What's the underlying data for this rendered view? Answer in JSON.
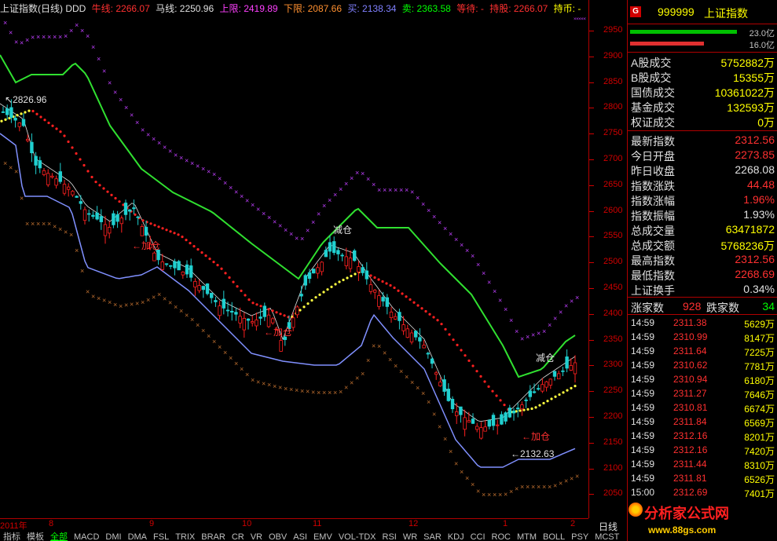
{
  "header": {
    "title": "上证指数(日线) DDD",
    "niu_label": "牛线:",
    "niu_value": "2266.07",
    "ma_label": "马线:",
    "ma_value": "2250.96",
    "upper_label": "上限:",
    "upper_value": "2419.89",
    "lower_label": "下限:",
    "lower_value": "2087.66",
    "buy_label": "买:",
    "buy_value": "2138.34",
    "sell_label": "卖:",
    "sell_value": "2363.58",
    "wait_label": "等待:",
    "wait_value": "-",
    "hold_label": "持股:",
    "hold_value": "2266.07",
    "holdcoin_label": "持币:",
    "holdcoin_value": "-"
  },
  "price_axis": [
    "2950",
    "2900",
    "2850",
    "2800",
    "2750",
    "2700",
    "2650",
    "2600",
    "2550",
    "2500",
    "2450",
    "2400",
    "2350",
    "2300",
    "2250",
    "2200",
    "2150",
    "2100",
    "2050"
  ],
  "time_axis": {
    "labels": [
      "2011年",
      "8",
      "9",
      "10",
      "11",
      "12",
      "1",
      "2"
    ],
    "period": "日线"
  },
  "chart_annotations": {
    "high_marker": "2826.96",
    "low_marker": "2132.63",
    "signals": [
      "加仓",
      "加仓",
      "减仓",
      "减仓",
      "加仓"
    ]
  },
  "bottom_tabs": [
    "指标",
    "模板",
    "全部",
    "MACD",
    "DMI",
    "DMA",
    "FSL",
    "TRIX",
    "BRAR",
    "CR",
    "VR",
    "OBV",
    "ASI",
    "EMV",
    "VOL-TDX",
    "RSI",
    "WR",
    "SAR",
    "KDJ",
    "CCI",
    "ROC",
    "MTM",
    "BOLL",
    "PSY",
    "MCST"
  ],
  "active_tab": "全部",
  "quote": {
    "badge": "G",
    "code": "999999",
    "name": "上证指数",
    "up_volume": "23.0亿",
    "down_volume": "16.0亿",
    "up_color": "#00c000",
    "down_color": "#e03030",
    "volumes": [
      {
        "label": "A股成交",
        "value": "5752882万"
      },
      {
        "label": "B股成交",
        "value": "15355万"
      },
      {
        "label": "国债成交",
        "value": "10361022万"
      },
      {
        "label": "基金成交",
        "value": "132593万"
      },
      {
        "label": "权证成交",
        "value": "0万"
      }
    ],
    "indices": [
      {
        "label": "最新指数",
        "value": "2312.56",
        "color": "#ff3030"
      },
      {
        "label": "今日开盘",
        "value": "2273.85",
        "color": "#ff3030"
      },
      {
        "label": "昨日收盘",
        "value": "2268.08",
        "color": "#e0e0e0"
      },
      {
        "label": "指数涨跌",
        "value": "44.48",
        "color": "#ff3030"
      },
      {
        "label": "指数涨幅",
        "value": "1.96%",
        "color": "#ff3030"
      },
      {
        "label": "指数振幅",
        "value": "1.93%",
        "color": "#e0e0e0"
      },
      {
        "label": "总成交量",
        "value": "63471872",
        "color": "#ffff00"
      },
      {
        "label": "总成交额",
        "value": "5768236万",
        "color": "#ffff00"
      },
      {
        "label": "最高指数",
        "value": "2312.56",
        "color": "#ff3030"
      },
      {
        "label": "最低指数",
        "value": "2268.69",
        "color": "#ff3030"
      },
      {
        "label": "上证换手",
        "value": "0.34%",
        "color": "#e0e0e0"
      }
    ],
    "breadth": {
      "up_label": "涨家数",
      "up_value": "928",
      "down_label": "跌家数",
      "down_value": "34"
    },
    "ticks": [
      {
        "time": "14:59",
        "price": "2311.38",
        "vol": "5629万"
      },
      {
        "time": "14:59",
        "price": "2310.99",
        "vol": "8147万"
      },
      {
        "time": "14:59",
        "price": "2311.64",
        "vol": "7225万"
      },
      {
        "time": "14:59",
        "price": "2310.62",
        "vol": "7781万"
      },
      {
        "time": "14:59",
        "price": "2310.94",
        "vol": "6180万"
      },
      {
        "time": "14:59",
        "price": "2311.27",
        "vol": "7646万"
      },
      {
        "time": "14:59",
        "price": "2310.81",
        "vol": "6674万"
      },
      {
        "time": "14:59",
        "price": "2311.84",
        "vol": "6569万"
      },
      {
        "time": "14:59",
        "price": "2312.16",
        "vol": "8201万"
      },
      {
        "time": "14:59",
        "price": "2312.16",
        "vol": "7420万"
      },
      {
        "time": "14:59",
        "price": "2311.44",
        "vol": "8310万"
      },
      {
        "time": "14:59",
        "price": "2311.81",
        "vol": "6526万"
      },
      {
        "time": "15:00",
        "price": "2312.69",
        "vol": "7401万"
      }
    ]
  },
  "watermark": {
    "text": "分析家公式网",
    "url": "www.88gs.com"
  }
}
